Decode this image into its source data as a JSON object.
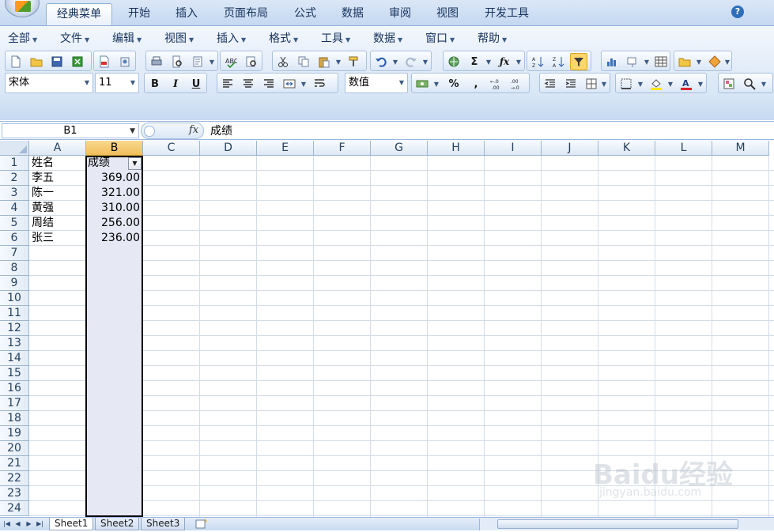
{
  "ribbon_tabs": [
    "经典菜单",
    "开始",
    "插入",
    "页面布局",
    "公式",
    "数据",
    "审阅",
    "视图",
    "开发工具"
  ],
  "help_label": "?",
  "menu": [
    "全部",
    "文件",
    "编辑",
    "视图",
    "插入",
    "格式",
    "工具",
    "数据",
    "窗口",
    "帮助"
  ],
  "format": {
    "font_name": "宋体",
    "font_size": "11",
    "number_format": "数值",
    "bold_label": "B",
    "italic_label": "I",
    "underline_label": "U",
    "percent_label": "%",
    "comma_label": ","
  },
  "formula_bar": {
    "name_box": "B1",
    "fx_label": "fx",
    "formula": "成绩"
  },
  "columns": [
    "A",
    "B",
    "C",
    "D",
    "E",
    "F",
    "G",
    "H",
    "I",
    "J",
    "K",
    "L",
    "M"
  ],
  "selected_column": "B",
  "rows": [
    "1",
    "2",
    "3",
    "4",
    "5",
    "6",
    "7",
    "8",
    "9",
    "10",
    "11",
    "12",
    "13",
    "14",
    "15",
    "16",
    "17",
    "18",
    "19",
    "20",
    "21",
    "22",
    "23",
    "24"
  ],
  "header_row": {
    "name": "姓名",
    "score": "成绩"
  },
  "records": [
    {
      "name": "李五",
      "score": "369.00"
    },
    {
      "name": "陈一",
      "score": "321.00"
    },
    {
      "name": "黄强",
      "score": "310.00"
    },
    {
      "name": "周结",
      "score": "256.00"
    },
    {
      "name": "张三",
      "score": "236.00"
    }
  ],
  "sheets": [
    "Sheet1",
    "Sheet2",
    "Sheet3"
  ],
  "active_sheet": "Sheet1",
  "watermark": {
    "logo": "Baidu经验",
    "url": "jingyan.baidu.com"
  },
  "colors": {
    "selection_header": "#f1bd5b",
    "selected_column_fill": "#e6e8f4",
    "ribbon_text": "#15315b"
  }
}
